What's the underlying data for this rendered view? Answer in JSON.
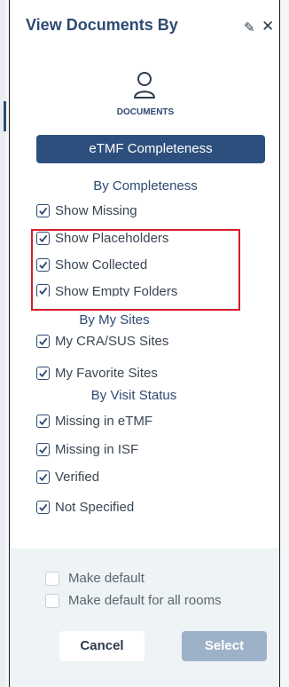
{
  "panel": {
    "title": "View Documents By",
    "documents_label": "DOCUMENTS",
    "mode_button": "eTMF Completeness"
  },
  "icons": {
    "edit": "pencil-icon",
    "close": "close-icon",
    "documents": "person-icon"
  },
  "sections": {
    "completeness": {
      "heading": "By Completeness",
      "options": [
        {
          "label": "Show Missing",
          "checked": true
        },
        {
          "label": "Show Placeholders",
          "checked": true
        },
        {
          "label": "Show Collected",
          "checked": true
        },
        {
          "label": "Show Empty Folders",
          "checked": true
        }
      ]
    },
    "sites": {
      "heading": "By My Sites",
      "options": [
        {
          "label": "My CRA/SUS Sites",
          "checked": true
        },
        {
          "label": "My Favorite Sites",
          "checked": true
        }
      ]
    },
    "visit": {
      "heading": "By Visit Status",
      "options": [
        {
          "label": "Missing in eTMF",
          "checked": true
        },
        {
          "label": "Missing in ISF",
          "checked": true
        },
        {
          "label": "Verified",
          "checked": true
        },
        {
          "label": "Not Specified",
          "checked": true
        }
      ]
    }
  },
  "footer": {
    "make_default": "Make default",
    "make_default_all": "Make default for all rooms",
    "cancel": "Cancel",
    "select": "Select"
  },
  "colors": {
    "accent": "#2d4f7d",
    "highlight": "#d41e2a",
    "select_disabled": "#9db2c8"
  }
}
